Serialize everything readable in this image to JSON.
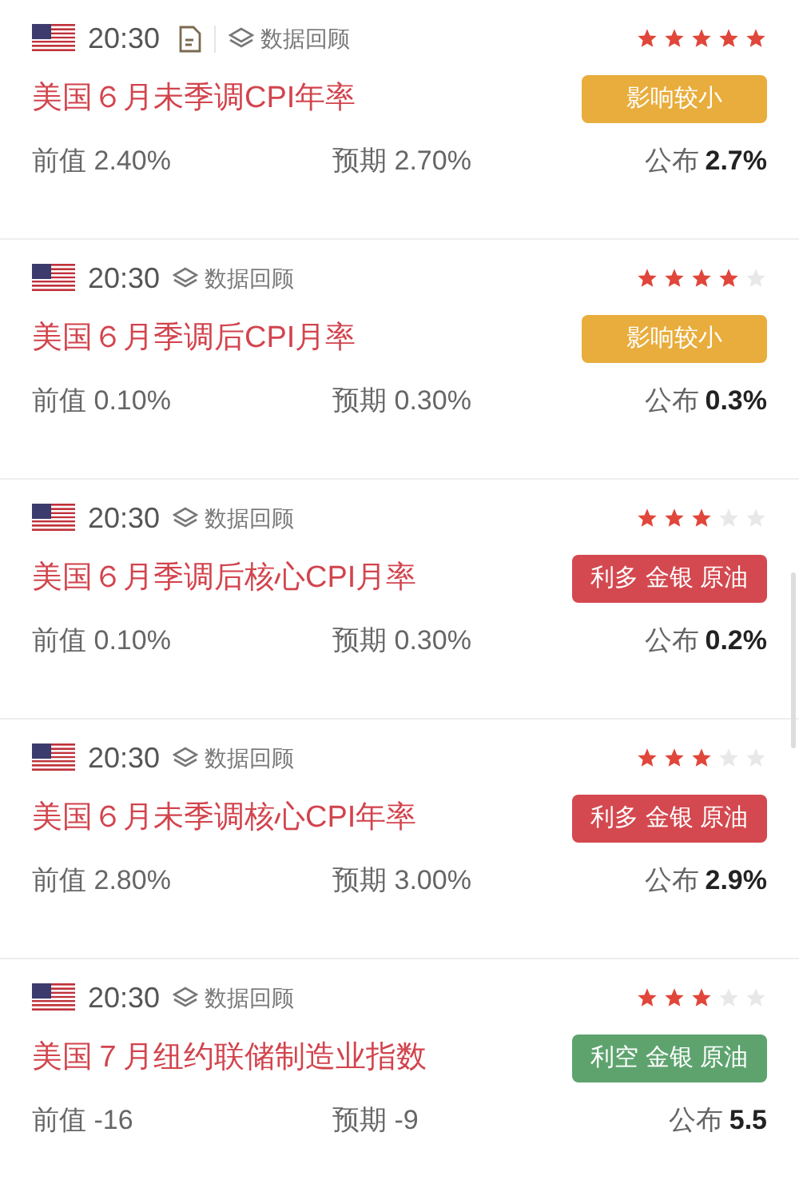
{
  "events": [
    {
      "time": "20:30",
      "document": true,
      "review": "数据回顾",
      "stars": 5,
      "title": "美国６月未季调CPI年率",
      "tag": {
        "kind": "minor",
        "text": "影响较小"
      },
      "previous": {
        "label": "前值",
        "value": "2.40%"
      },
      "forecast": {
        "label": "预期",
        "value": "2.70%"
      },
      "actual": {
        "label": "公布",
        "value": "2.7%"
      }
    },
    {
      "time": "20:30",
      "document": false,
      "review": "数据回顾",
      "stars": 4,
      "title": "美国６月季调后CPI月率",
      "tag": {
        "kind": "minor",
        "text": "影响较小"
      },
      "previous": {
        "label": "前值",
        "value": "0.10%"
      },
      "forecast": {
        "label": "预期",
        "value": "0.30%"
      },
      "actual": {
        "label": "公布",
        "value": "0.3%"
      }
    },
    {
      "time": "20:30",
      "document": false,
      "review": "数据回顾",
      "stars": 3,
      "title": "美国６月季调后核心CPI月率",
      "tag": {
        "kind": "bullish",
        "text": "利多 金银 原油"
      },
      "previous": {
        "label": "前值",
        "value": "0.10%"
      },
      "forecast": {
        "label": "预期",
        "value": "0.30%"
      },
      "actual": {
        "label": "公布",
        "value": "0.2%"
      }
    },
    {
      "time": "20:30",
      "document": false,
      "review": "数据回顾",
      "stars": 3,
      "title": "美国６月未季调核心CPI年率",
      "tag": {
        "kind": "bullish",
        "text": "利多 金银 原油"
      },
      "previous": {
        "label": "前值",
        "value": "2.80%"
      },
      "forecast": {
        "label": "预期",
        "value": "3.00%"
      },
      "actual": {
        "label": "公布",
        "value": "2.9%"
      }
    },
    {
      "time": "20:30",
      "document": false,
      "review": "数据回顾",
      "stars": 3,
      "title": "美国７月纽约联储制造业指数",
      "tag": {
        "kind": "bearish",
        "text": "利空 金银 原油"
      },
      "previous": {
        "label": "前值",
        "value": "-16"
      },
      "forecast": {
        "label": "预期",
        "value": "-9"
      },
      "actual": {
        "label": "公布",
        "value": "5.5"
      }
    }
  ]
}
